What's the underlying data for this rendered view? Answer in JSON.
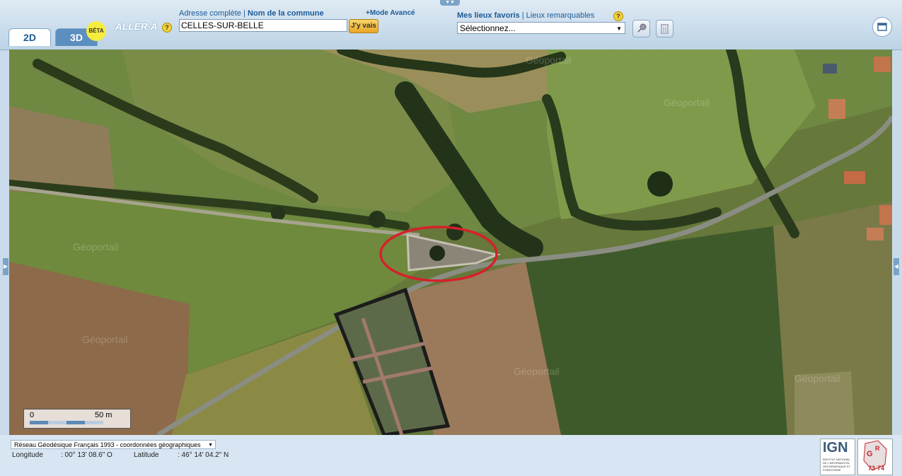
{
  "toolbar": {
    "tabs": [
      "2D",
      "3D"
    ],
    "beta_badge": "BÉTA",
    "goto_label": "ALLER À",
    "help_glyph": "?",
    "address_link": "Adresse complète",
    "separator": "|",
    "commune_link": "Nom de la commune",
    "advanced_mode": "+Mode Avancé",
    "search_value": "CELLES-SUR-BELLE",
    "go_button": "J'y vais",
    "favorites_link": "Mes lieux favoris",
    "landmarks_link": "Lieux remarquables",
    "favorites_select": "Sélectionnez...",
    "icons": [
      "pin-icon",
      "trash-icon",
      "window-icon"
    ]
  },
  "map": {
    "watermark": "Géoportail",
    "annotation_color": "#d6202a",
    "scale": {
      "start": "0",
      "end": "50 m"
    }
  },
  "footer": {
    "projection": "Réseau Géodésique Français 1993 - coordonnées géographiques",
    "longitude_label": "Longitude",
    "longitude_value": ": 00° 13' 08.6\" O",
    "latitude_label": "Latitude",
    "latitude_value": ": 46° 14' 04.2\" N",
    "logo_ign": "IGN",
    "logo_ign_caption": "INSTITUT NATIONAL DE L'INFORMATION GÉOGRAPHIQUE ET FORESTIÈRE",
    "logo_cgr": "73-74"
  }
}
